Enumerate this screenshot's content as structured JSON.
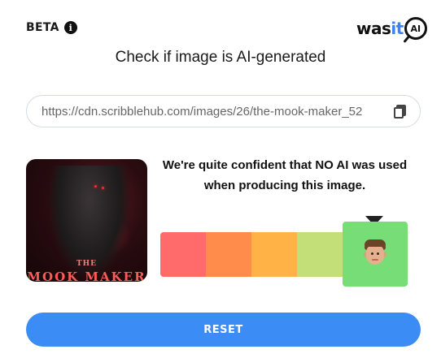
{
  "header": {
    "beta_label": "BETA",
    "info_icon": "i",
    "logo": {
      "prefix": "was",
      "highlight": "it",
      "badge": "AI"
    }
  },
  "title": "Check if image is AI-generated",
  "url_input": {
    "value": "https://cdn.scribblehub.com/images/26/the-mook-maker_52"
  },
  "thumbnail": {
    "cover_top": "THE",
    "cover_title": "MOOK MAKER"
  },
  "verdict": {
    "line1": "We're quite confident that NO AI was used",
    "line2": "when producing this image."
  },
  "scale": {
    "colors": [
      "#ff6b6b",
      "#ff8c4a",
      "#ffb347",
      "#c3e078",
      "#77dd77"
    ],
    "active_index": 4,
    "active_icon": "man-face-emoji"
  },
  "reset_label": "RESET"
}
